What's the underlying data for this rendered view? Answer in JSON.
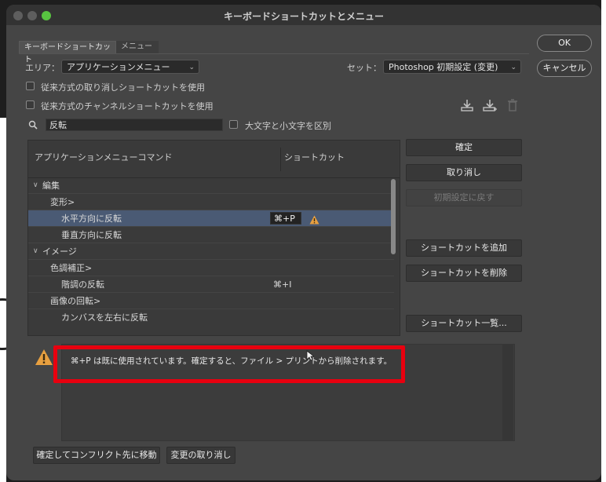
{
  "window": {
    "title": "キーボードショートカットとメニュー"
  },
  "tabs": [
    {
      "label": "キーボードショートカット",
      "active": true
    },
    {
      "label": "メニュー",
      "active": false
    }
  ],
  "area": {
    "label": "エリア：",
    "value": "アプリケーションメニュー"
  },
  "set": {
    "label": "セット：",
    "value": "Photoshop 初期設定 (変更)"
  },
  "options": [
    {
      "label": "従来方式の取り消しショートカットを使用",
      "checked": false
    },
    {
      "label": "従来方式のチャンネルショートカットを使用",
      "checked": false
    }
  ],
  "search": {
    "value": "反転",
    "case_label": "大文字と小文字を区別",
    "case_checked": false
  },
  "table": {
    "headers": [
      "アプリケーションメニューコマンド",
      "ショートカット"
    ],
    "rows": [
      {
        "level": 0,
        "expanded": true,
        "label": "編集",
        "shortcut": "",
        "selected": false,
        "warning": false
      },
      {
        "level": 1,
        "label": "変形>",
        "shortcut": "",
        "selected": false,
        "warning": false
      },
      {
        "level": 2,
        "label": "水平方向に反転",
        "shortcut": "⌘+P",
        "selected": true,
        "warning": true
      },
      {
        "level": 2,
        "label": "垂直方向に反転",
        "shortcut": "",
        "selected": false,
        "warning": false
      },
      {
        "level": 0,
        "expanded": true,
        "label": "イメージ",
        "shortcut": "",
        "selected": false,
        "warning": false
      },
      {
        "level": 1,
        "label": "色調補正>",
        "shortcut": "",
        "selected": false,
        "warning": false
      },
      {
        "level": 2,
        "label": "階調の反転",
        "shortcut": "⌘+I",
        "selected": false,
        "warning": false
      },
      {
        "level": 1,
        "label": "画像の回転>",
        "shortcut": "",
        "selected": false,
        "warning": false
      },
      {
        "level": 2,
        "label": "カンバスを左右に反転",
        "shortcut": "",
        "selected": false,
        "warning": false
      }
    ]
  },
  "side_buttons": {
    "ok": "OK",
    "cancel": "キャンセル",
    "accept": "確定",
    "undo": "取り消し",
    "reset": "初期設定に戻す",
    "add": "ショートカットを追加",
    "delete": "ショートカットを削除",
    "summarize": "ショートカット一覧..."
  },
  "message": "⌘+P は既に使用されています。確定すると、ファイル > プリントから削除されます。",
  "bottom_buttons": {
    "goto_conflict": "確定してコンフリクト先に移動",
    "undo_changes": "変更の取り消し"
  },
  "colors": {
    "highlight": "#e8000f",
    "selection": "#4a5a74",
    "warning": "#e8a040"
  }
}
